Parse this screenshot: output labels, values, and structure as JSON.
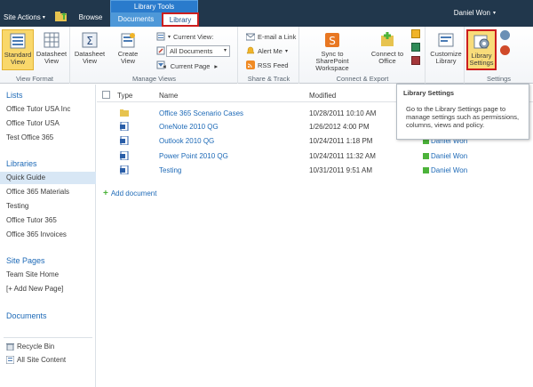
{
  "topbar": {
    "site_actions": "Site Actions",
    "site_actions_arrow": "▾",
    "tab_browse": "Browse",
    "tool_context": "Library Tools",
    "tab_documents": "Documents",
    "tab_library": "Library",
    "user_name": "Daniel Won",
    "user_arrow": "▾"
  },
  "ribbon": {
    "view_format": {
      "label": "View Format",
      "standard_view": "Standard View",
      "datasheet_view": "Datasheet View"
    },
    "manage_views": {
      "label": "Manage Views",
      "datasheet": "Datasheet View",
      "create_view": "Create View",
      "current_view_label": "Current View:",
      "current_view_value": "All Documents",
      "current_page": "Current Page",
      "prev": "◂",
      "next": "▸"
    },
    "share_track": {
      "label": "Share & Track",
      "email_link": "E-mail a Link",
      "alert_me": "Alert Me",
      "rss_feed": "RSS Feed"
    },
    "connect_export": {
      "label": "Connect & Export",
      "sync": "Sync to SharePoint Workspace",
      "connect_office": "Connect to Office"
    },
    "customize": {
      "customize_library": "Customize Library"
    },
    "settings": {
      "label": "Settings",
      "library_settings": "Library Settings"
    }
  },
  "leftnav": {
    "lists_heading": "Lists",
    "lists": [
      "Office Tutor USA Inc",
      "Office Tutor USA",
      "Test Office 365"
    ],
    "libraries_heading": "Libraries",
    "libraries": [
      "Quick Guide",
      "Office 365 Materials",
      "Testing",
      "Office Tutor 365",
      "Office 365 Invoices"
    ],
    "site_pages_heading": "Site Pages",
    "site_pages": [
      "Team Site Home",
      "[+ Add New Page]"
    ],
    "documents_heading": "Documents",
    "recycle_bin": "Recycle Bin",
    "all_site_content": "All Site Content"
  },
  "list": {
    "headers": {
      "type": "Type",
      "name": "Name",
      "modified": "Modified"
    },
    "rows": [
      {
        "type": "folder",
        "name": "Office 365 Scenario Cases",
        "modified": "10/28/2011 10:10 AM",
        "by": ""
      },
      {
        "type": "doc",
        "name": "OneNote 2010 QG",
        "modified": "1/26/2012 4:00 PM",
        "by": ""
      },
      {
        "type": "doc",
        "name": "Outlook 2010 QG",
        "modified": "10/24/2011 1:18 PM",
        "by": "Daniel Won"
      },
      {
        "type": "doc",
        "name": "Power Point 2010 QG",
        "modified": "10/24/2011 11:32 AM",
        "by": "Daniel Won"
      },
      {
        "type": "doc",
        "name": "Testing",
        "modified": "10/31/2011 9:51 AM",
        "by": "Daniel Won"
      }
    ],
    "add_document": "Add document"
  },
  "tooltip": {
    "title": "Library Settings",
    "body": "Go to the Library Settings page to manage settings such as permissions, columns, views and policy."
  }
}
